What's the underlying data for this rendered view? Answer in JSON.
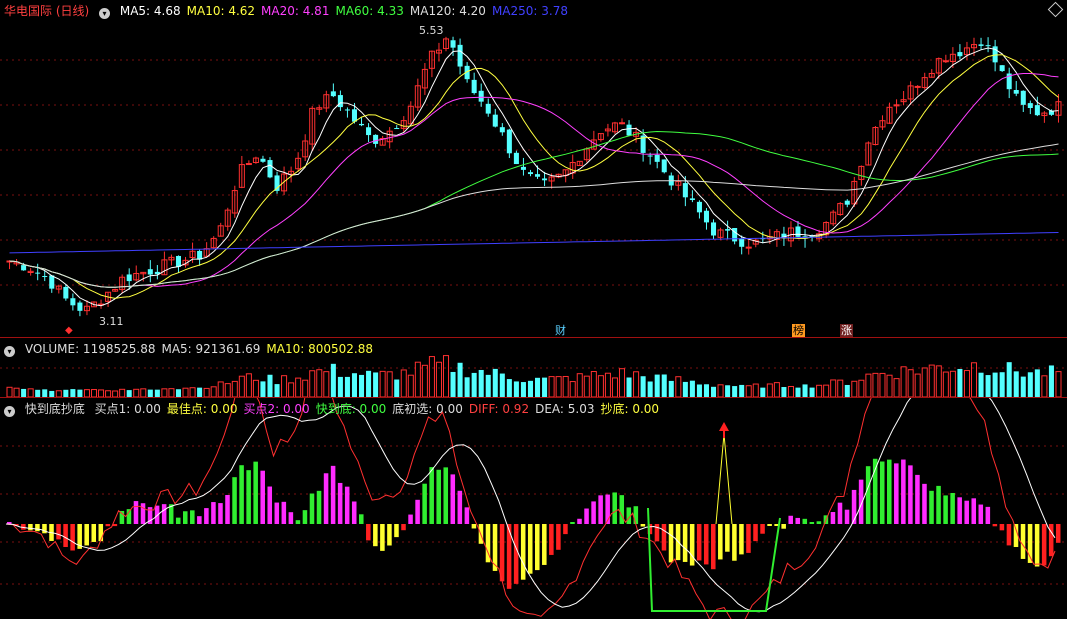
{
  "price_panel": {
    "title": "华电国际 (日线)",
    "ma": [
      {
        "label": "MA5: 4.68",
        "color": "#ffffff"
      },
      {
        "label": "MA10: 4.62",
        "color": "#ffff40"
      },
      {
        "label": "MA20: 4.81",
        "color": "#ff40ff"
      },
      {
        "label": "MA60: 4.33",
        "color": "#40ff40"
      },
      {
        "label": "MA120: 4.20",
        "color": "#dddddd"
      },
      {
        "label": "MA250: 3.78",
        "color": "#4040ff"
      }
    ],
    "high_label": "5.53",
    "low_label": "3.11",
    "tags": [
      {
        "text": "财",
        "color": "#5ad0ff",
        "bg": "#000000"
      },
      {
        "text": "榜",
        "color": "#000000",
        "bg": "#ff9a20"
      },
      {
        "text": "涨",
        "color": "#ffffff",
        "bg": "#702020"
      }
    ]
  },
  "volume_panel": {
    "labels": [
      {
        "text": "VOLUME: 1198525.88",
        "color": "#dddddd"
      },
      {
        "text": "MA5: 921361.69",
        "color": "#dddddd"
      },
      {
        "text": "MA10: 800502.88",
        "color": "#ffff40"
      }
    ]
  },
  "indicator_panel": {
    "name": "快到底抄底",
    "labels": [
      {
        "text": "买点1: 0.00",
        "color": "#dddddd"
      },
      {
        "text": "最佳点: 0.00",
        "color": "#ffff40"
      },
      {
        "text": "买点2: 0.00",
        "color": "#ff40ff"
      },
      {
        "text": "快到底: 0.00",
        "color": "#40ff40"
      },
      {
        "text": "底初选: 0.00",
        "color": "#dddddd"
      },
      {
        "text": "DIFF: 0.92",
        "color": "#ff4040"
      },
      {
        "text": "DEA: 5.03",
        "color": "#dddddd"
      },
      {
        "text": "抄底: 0.00",
        "color": "#ffff40"
      }
    ]
  },
  "chart_data": {
    "type": "candlestick",
    "price_close_path": [
      3.55,
      3.5,
      3.4,
      3.2,
      3.11,
      3.25,
      3.4,
      3.45,
      3.5,
      3.55,
      3.6,
      3.8,
      4.3,
      4.5,
      4.2,
      4.4,
      4.9,
      5.0,
      4.8,
      4.6,
      4.7,
      4.9,
      5.3,
      5.53,
      5.1,
      4.9,
      4.6,
      4.3,
      4.2,
      4.3,
      4.5,
      4.7,
      4.75,
      4.6,
      4.4,
      4.2,
      4.0,
      3.8,
      3.75,
      3.7,
      3.75,
      3.8,
      3.8,
      3.9,
      4.1,
      4.6,
      4.9,
      5.0,
      5.2,
      5.35,
      5.4,
      5.5,
      5.2,
      4.9,
      4.85,
      4.9
    ]
  }
}
